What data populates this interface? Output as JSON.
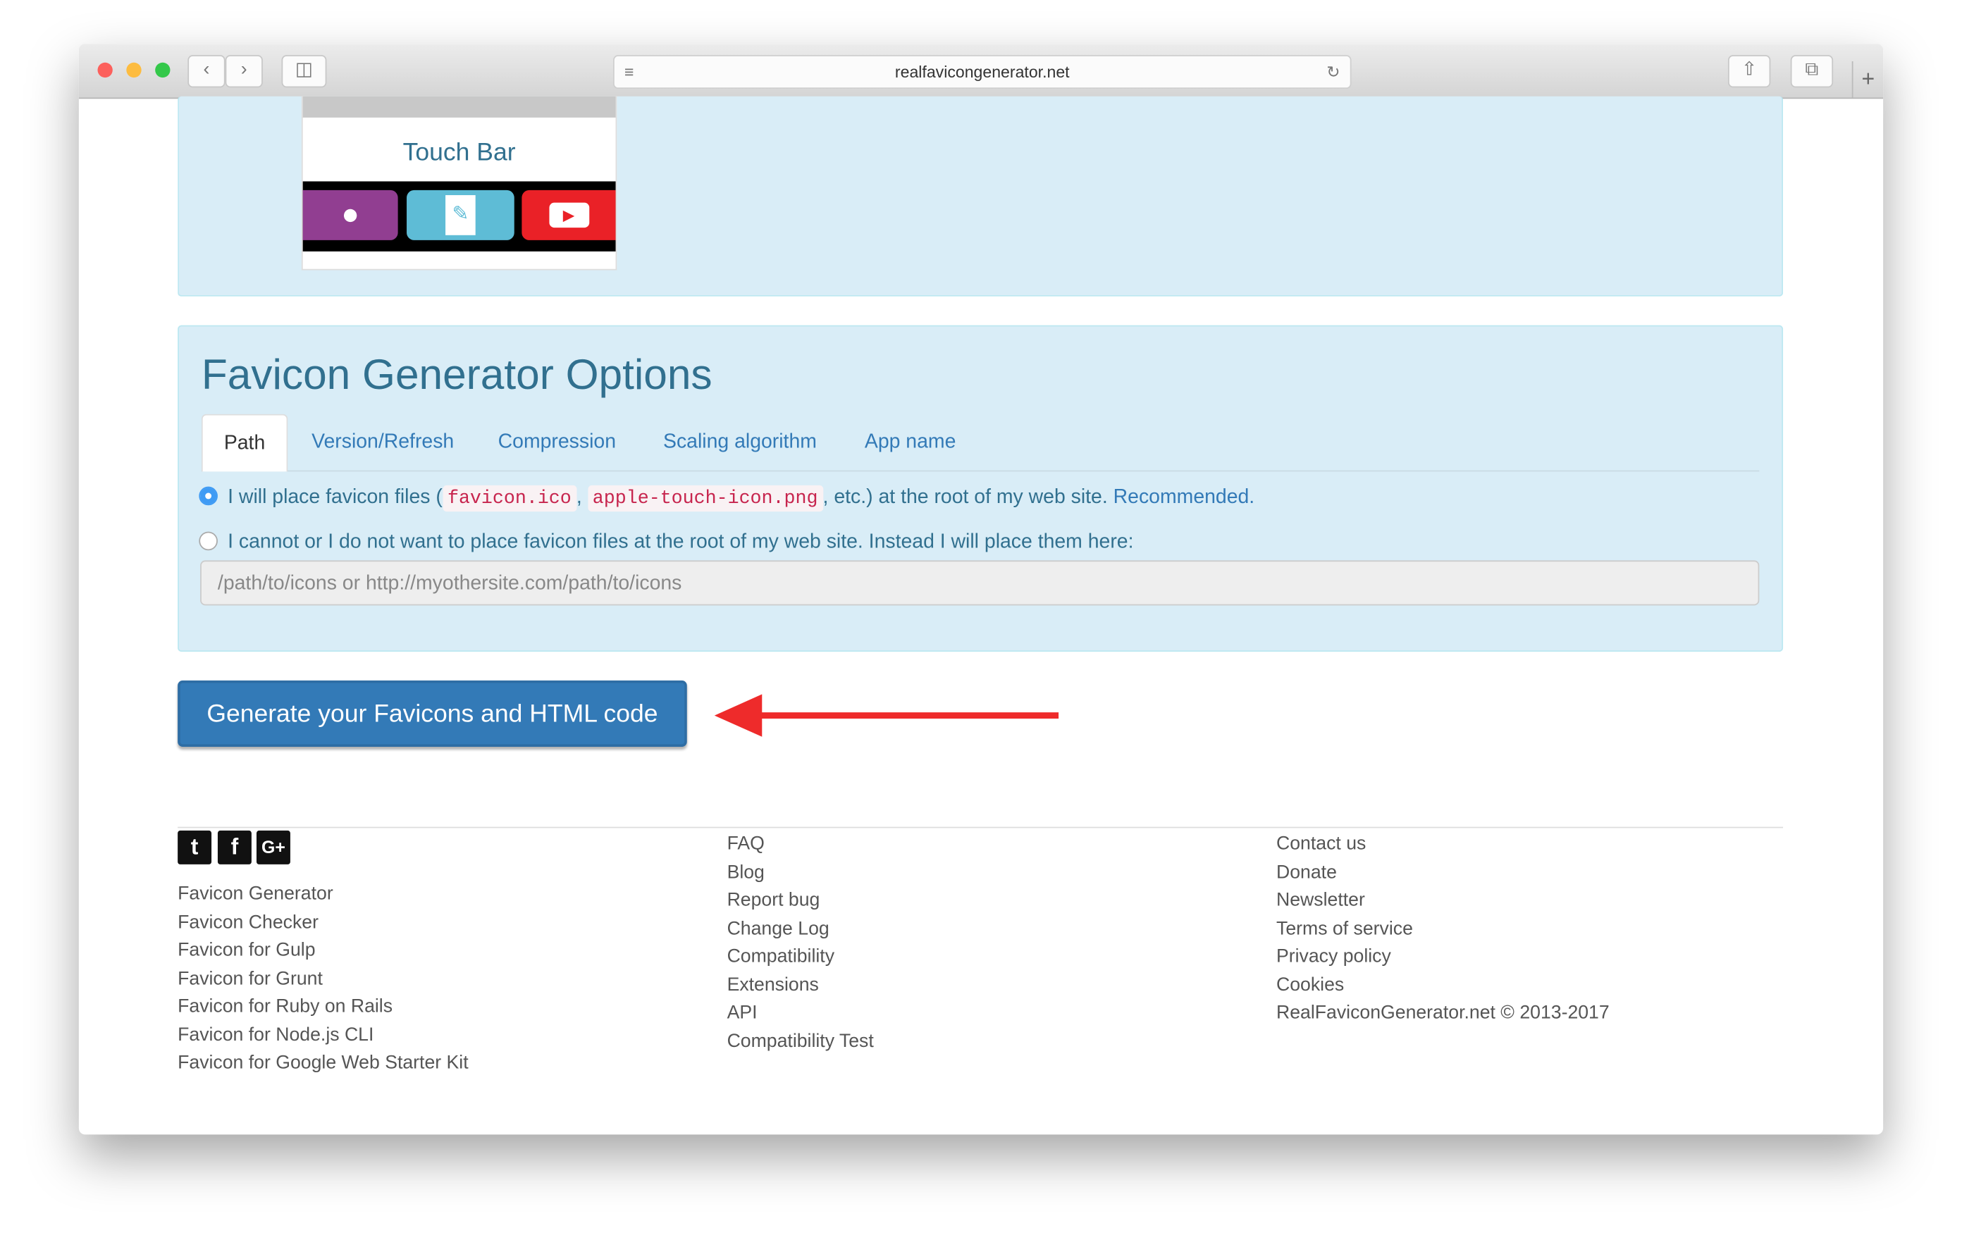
{
  "browser": {
    "url": "realfavicongenerator.net"
  },
  "touchbar": {
    "title": "Touch Bar"
  },
  "options": {
    "title": "Favicon Generator Options",
    "tabs": [
      {
        "label": "Path"
      },
      {
        "label": "Version/Refresh"
      },
      {
        "label": "Compression"
      },
      {
        "label": "Scaling algorithm"
      },
      {
        "label": "App name"
      }
    ],
    "radio1": {
      "pre": "I will place favicon files (",
      "code1": "favicon.ico",
      "sep": ",",
      "code2": "apple-touch-icon.png",
      "post": ", etc.) at the root of my web site.",
      "link": "Recommended.",
      "checked": true
    },
    "radio2": {
      "label": "I cannot or I do not want to place favicon files at the root of my web site. Instead I will place them here:",
      "checked": false
    },
    "path_input": {
      "placeholder": "/path/to/icons or http://myothersite.com/path/to/icons",
      "value": ""
    }
  },
  "generate_button": "Generate your Favicons and HTML code",
  "colors": {
    "accent": "#337ab7",
    "arrow": "#ee2b2b",
    "panel": "#d9edf7"
  },
  "footer": {
    "social": [
      "twitter-icon",
      "facebook-icon",
      "google-plus-icon"
    ],
    "col1": [
      "Favicon Generator",
      "Favicon Checker",
      "Favicon for Gulp",
      "Favicon for Grunt",
      "Favicon for Ruby on Rails",
      "Favicon for Node.js CLI",
      "Favicon for Google Web Starter Kit"
    ],
    "col2": [
      "FAQ",
      "Blog",
      "Report bug",
      "Change Log",
      "Compatibility",
      "Extensions",
      "API",
      "Compatibility Test"
    ],
    "col3": [
      "Contact us",
      "Donate",
      "Newsletter",
      "Terms of service",
      "Privacy policy",
      "Cookies"
    ],
    "copyright": "RealFaviconGenerator.net © 2013-2017"
  }
}
